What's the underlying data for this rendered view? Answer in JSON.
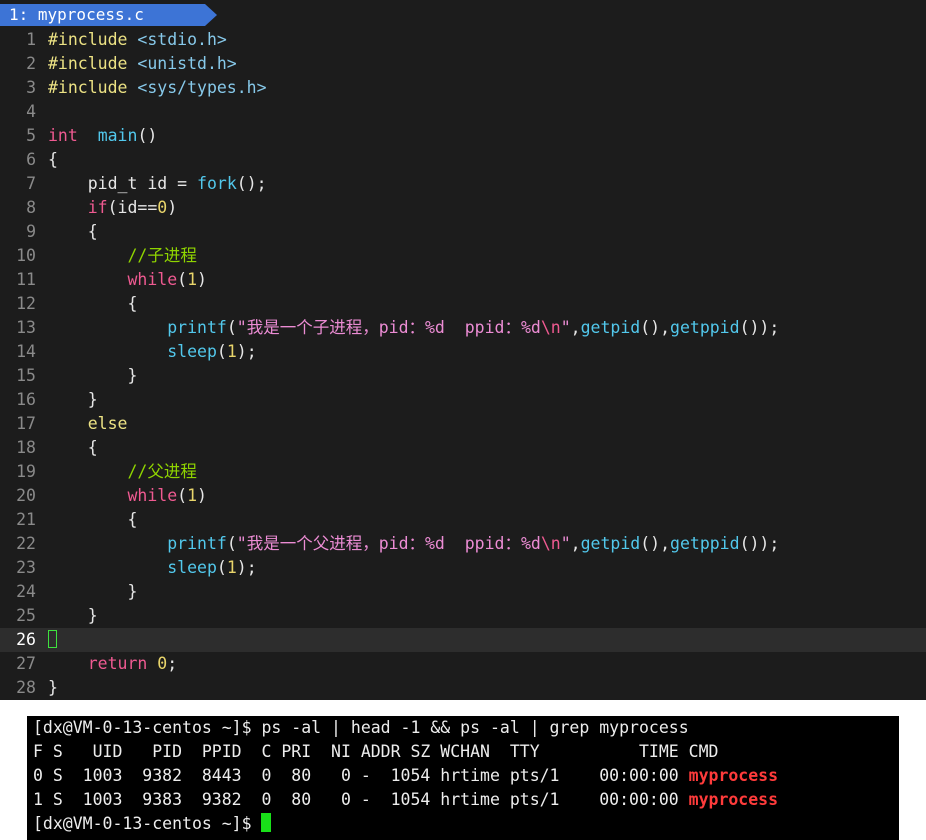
{
  "tab": {
    "label": "1: myprocess.c"
  },
  "code_lines": [
    {
      "n": "1",
      "tokens": [
        [
          "pp",
          "#include "
        ],
        [
          "inc",
          "<stdio.h>"
        ]
      ]
    },
    {
      "n": "2",
      "tokens": [
        [
          "pp",
          "#include "
        ],
        [
          "inc",
          "<unistd.h>"
        ]
      ]
    },
    {
      "n": "3",
      "tokens": [
        [
          "pp",
          "#include "
        ],
        [
          "inc",
          "<sys/types.h>"
        ]
      ]
    },
    {
      "n": "4",
      "tokens": []
    },
    {
      "n": "5",
      "tokens": [
        [
          "kw",
          "int"
        ],
        [
          "",
          "  "
        ],
        [
          "fn",
          "main"
        ],
        [
          "",
          "()"
        ]
      ]
    },
    {
      "n": "6",
      "tokens": [
        [
          "",
          "{"
        ]
      ]
    },
    {
      "n": "7",
      "tokens": [
        [
          "",
          "    pid_t id = "
        ],
        [
          "fn",
          "fork"
        ],
        [
          "",
          "();"
        ]
      ]
    },
    {
      "n": "8",
      "tokens": [
        [
          "",
          "    "
        ],
        [
          "kw",
          "if"
        ],
        [
          "",
          "(id=="
        ],
        [
          "num",
          "0"
        ],
        [
          "",
          ")"
        ]
      ]
    },
    {
      "n": "9",
      "tokens": [
        [
          "",
          "    {"
        ]
      ]
    },
    {
      "n": "10",
      "tokens": [
        [
          "",
          "        "
        ],
        [
          "cm",
          "//子进程"
        ]
      ]
    },
    {
      "n": "11",
      "tokens": [
        [
          "",
          "        "
        ],
        [
          "kw",
          "while"
        ],
        [
          "",
          "("
        ],
        [
          "num",
          "1"
        ],
        [
          "",
          ")"
        ]
      ]
    },
    {
      "n": "12",
      "tokens": [
        [
          "",
          "        {"
        ]
      ]
    },
    {
      "n": "13",
      "tokens": [
        [
          "",
          "            "
        ],
        [
          "fn",
          "printf"
        ],
        [
          "",
          "("
        ],
        [
          "str",
          "\"我是一个子进程，pid：%d  ppid：%d"
        ],
        [
          "esc",
          "\\n"
        ],
        [
          "str",
          "\""
        ],
        [
          "",
          ","
        ],
        [
          "fn",
          "getpid"
        ],
        [
          "",
          "(),"
        ],
        [
          "fn",
          "getppid"
        ],
        [
          "",
          "());"
        ]
      ]
    },
    {
      "n": "14",
      "tokens": [
        [
          "",
          "            "
        ],
        [
          "fn",
          "sleep"
        ],
        [
          "",
          "("
        ],
        [
          "num",
          "1"
        ],
        [
          "",
          ");"
        ]
      ]
    },
    {
      "n": "15",
      "tokens": [
        [
          "",
          "        }"
        ]
      ]
    },
    {
      "n": "16",
      "tokens": [
        [
          "",
          "    }"
        ]
      ]
    },
    {
      "n": "17",
      "tokens": [
        [
          "",
          "    "
        ],
        [
          "pp",
          "else"
        ]
      ]
    },
    {
      "n": "18",
      "tokens": [
        [
          "",
          "    {"
        ]
      ]
    },
    {
      "n": "19",
      "tokens": [
        [
          "",
          "        "
        ],
        [
          "cm",
          "//父进程"
        ]
      ]
    },
    {
      "n": "20",
      "tokens": [
        [
          "",
          "        "
        ],
        [
          "kw",
          "while"
        ],
        [
          "",
          "("
        ],
        [
          "num",
          "1"
        ],
        [
          "",
          ")"
        ]
      ]
    },
    {
      "n": "21",
      "tokens": [
        [
          "",
          "        {"
        ]
      ]
    },
    {
      "n": "22",
      "tokens": [
        [
          "",
          "            "
        ],
        [
          "fn",
          "printf"
        ],
        [
          "",
          "("
        ],
        [
          "str",
          "\"我是一个父进程，pid：%d  ppid：%d"
        ],
        [
          "esc",
          "\\n"
        ],
        [
          "str",
          "\""
        ],
        [
          "",
          ","
        ],
        [
          "fn",
          "getpid"
        ],
        [
          "",
          "(),"
        ],
        [
          "fn",
          "getppid"
        ],
        [
          "",
          "());"
        ]
      ]
    },
    {
      "n": "23",
      "tokens": [
        [
          "",
          "            "
        ],
        [
          "fn",
          "sleep"
        ],
        [
          "",
          "("
        ],
        [
          "num",
          "1"
        ],
        [
          "",
          ");"
        ]
      ]
    },
    {
      "n": "24",
      "tokens": [
        [
          "",
          "        }"
        ]
      ]
    },
    {
      "n": "25",
      "tokens": [
        [
          "",
          "    }"
        ]
      ]
    },
    {
      "n": "26",
      "tokens": [],
      "current": true
    },
    {
      "n": "27",
      "tokens": [
        [
          "",
          "    "
        ],
        [
          "kw",
          "return"
        ],
        [
          "",
          ""
        ],
        [
          "num",
          " 0"
        ],
        [
          "",
          ";"
        ]
      ]
    },
    {
      "n": "28",
      "tokens": [
        [
          "",
          "}"
        ]
      ]
    }
  ],
  "terminal": {
    "command_line": "[dx@VM-0-13-centos ~]$ ps -al | head -1 && ps -al | grep myprocess",
    "header": "F S   UID   PID  PPID  C PRI  NI ADDR SZ WCHAN  TTY          TIME CMD",
    "rows": [
      {
        "text": "0 S  1003  9382  8443  0  80   0 -  1054 hrtime pts/1    00:00:00 ",
        "cmd": "myprocess"
      },
      {
        "text": "1 S  1003  9383  9382  0  80   0 -  1054 hrtime pts/1    00:00:00 ",
        "cmd": "myprocess"
      }
    ],
    "prompt": "[dx@VM-0-13-centos ~]$ "
  },
  "colors": {
    "editor_bg": "#1c1c1c",
    "tab_bg": "#3d74d6",
    "highlight": "#ff3b3b",
    "cursor": "#19e019"
  }
}
